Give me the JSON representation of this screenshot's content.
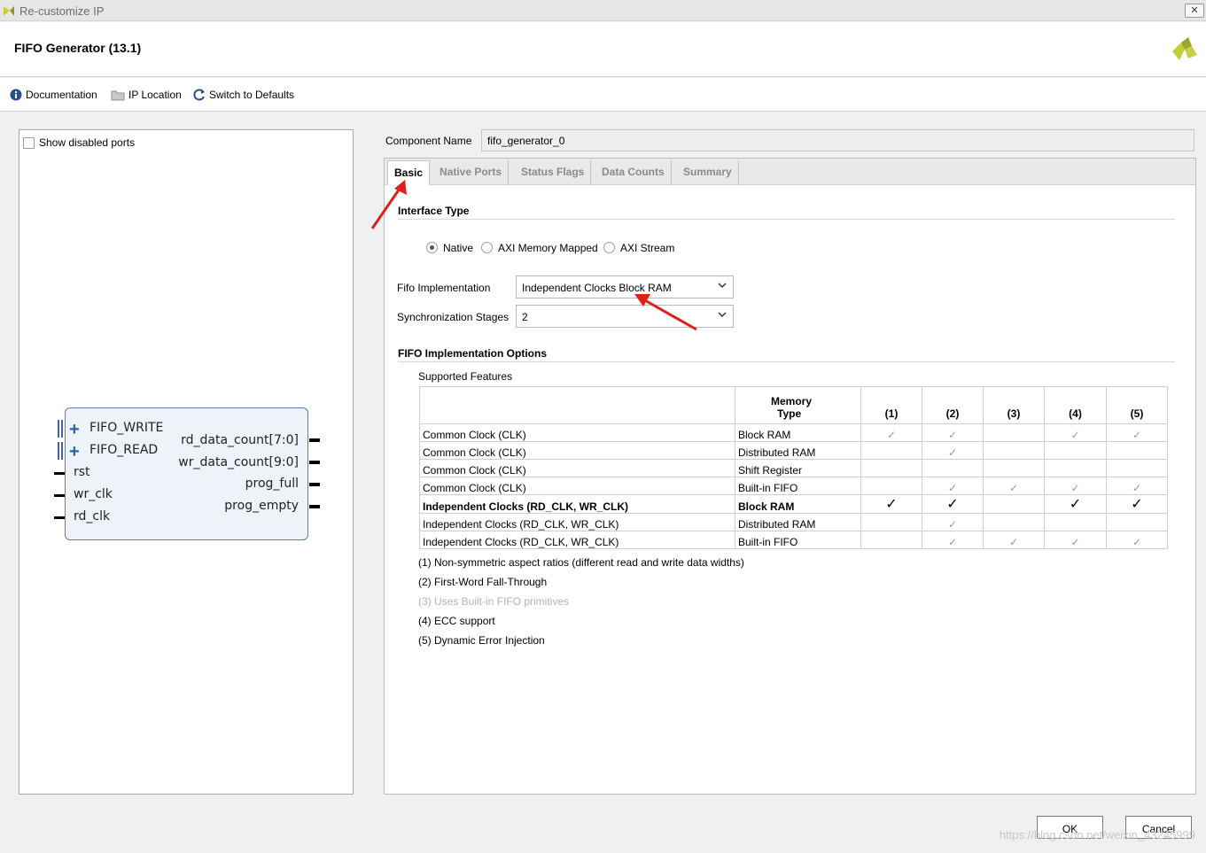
{
  "window": {
    "title": "Re-customize IP",
    "close": "✕"
  },
  "header": {
    "title": "FIFO Generator (13.1)"
  },
  "toolbar": {
    "documentation": "Documentation",
    "ip_location": "IP Location",
    "switch_defaults": "Switch to Defaults"
  },
  "left_panel": {
    "show_disabled_label": "Show disabled ports",
    "symbol": {
      "left_ports": [
        "FIFO_WRITE",
        "FIFO_READ",
        "rst",
        "wr_clk",
        "rd_clk"
      ],
      "right_ports": [
        "rd_data_count[7:0]",
        "wr_data_count[9:0]",
        "prog_full",
        "prog_empty"
      ]
    }
  },
  "component": {
    "label": "Component Name",
    "value": "fifo_generator_0"
  },
  "tabs": [
    "Basic",
    "Native Ports",
    "Status Flags",
    "Data Counts",
    "Summary"
  ],
  "basic": {
    "interface_type_title": "Interface Type",
    "interface_options": [
      "Native",
      "AXI Memory Mapped",
      "AXI Stream"
    ],
    "interface_selected": "Native",
    "fifo_impl_label": "Fifo Implementation",
    "fifo_impl_value": "Independent Clocks Block RAM",
    "sync_stages_label": "Synchronization Stages",
    "sync_stages_value": "2",
    "impl_options_title": "FIFO Implementation Options",
    "supported_features": "Supported Features",
    "table": {
      "header": {
        "memory_line1": "Memory",
        "memory_line2": "Type",
        "cols": [
          "(1)",
          "(2)",
          "(3)",
          "(4)",
          "(5)"
        ]
      },
      "rows": [
        {
          "clock": "Common Clock (CLK)",
          "memory": "Block RAM",
          "marks": [
            1,
            1,
            0,
            1,
            1
          ],
          "highlight": false
        },
        {
          "clock": "Common Clock (CLK)",
          "memory": "Distributed RAM",
          "marks": [
            0,
            1,
            0,
            0,
            0
          ],
          "highlight": false
        },
        {
          "clock": "Common Clock (CLK)",
          "memory": "Shift Register",
          "marks": [
            0,
            0,
            0,
            0,
            0
          ],
          "highlight": false
        },
        {
          "clock": "Common Clock (CLK)",
          "memory": "Built-in FIFO",
          "marks": [
            0,
            1,
            1,
            1,
            1
          ],
          "highlight": false
        },
        {
          "clock": "Independent Clocks (RD_CLK, WR_CLK)",
          "memory": "Block RAM",
          "marks": [
            1,
            1,
            0,
            1,
            1
          ],
          "highlight": true
        },
        {
          "clock": "Independent Clocks (RD_CLK, WR_CLK)",
          "memory": "Distributed RAM",
          "marks": [
            0,
            1,
            0,
            0,
            0
          ],
          "highlight": false
        },
        {
          "clock": "Independent Clocks (RD_CLK, WR_CLK)",
          "memory": "Built-in FIFO",
          "marks": [
            0,
            1,
            1,
            1,
            1
          ],
          "highlight": false
        }
      ]
    },
    "notes": [
      {
        "text": "(1) Non-symmetric aspect ratios (different read and write data widths)",
        "dim": false
      },
      {
        "text": "(2) First-Word Fall-Through",
        "dim": false
      },
      {
        "text": "(3) Uses Built-in FIFO primitives",
        "dim": true
      },
      {
        "text": "(4) ECC support",
        "dim": false
      },
      {
        "text": "(5) Dynamic Error Injection",
        "dim": false
      }
    ]
  },
  "buttons": {
    "ok": "OK",
    "cancel": "Cancel"
  },
  "watermark": "https://blog.csdn.net/weixin_43245999",
  "colors": {
    "accent": "#2f5fa4",
    "annotation_arrow": "#e0201a",
    "logo": "#b5c233"
  },
  "check_mark": "✓"
}
